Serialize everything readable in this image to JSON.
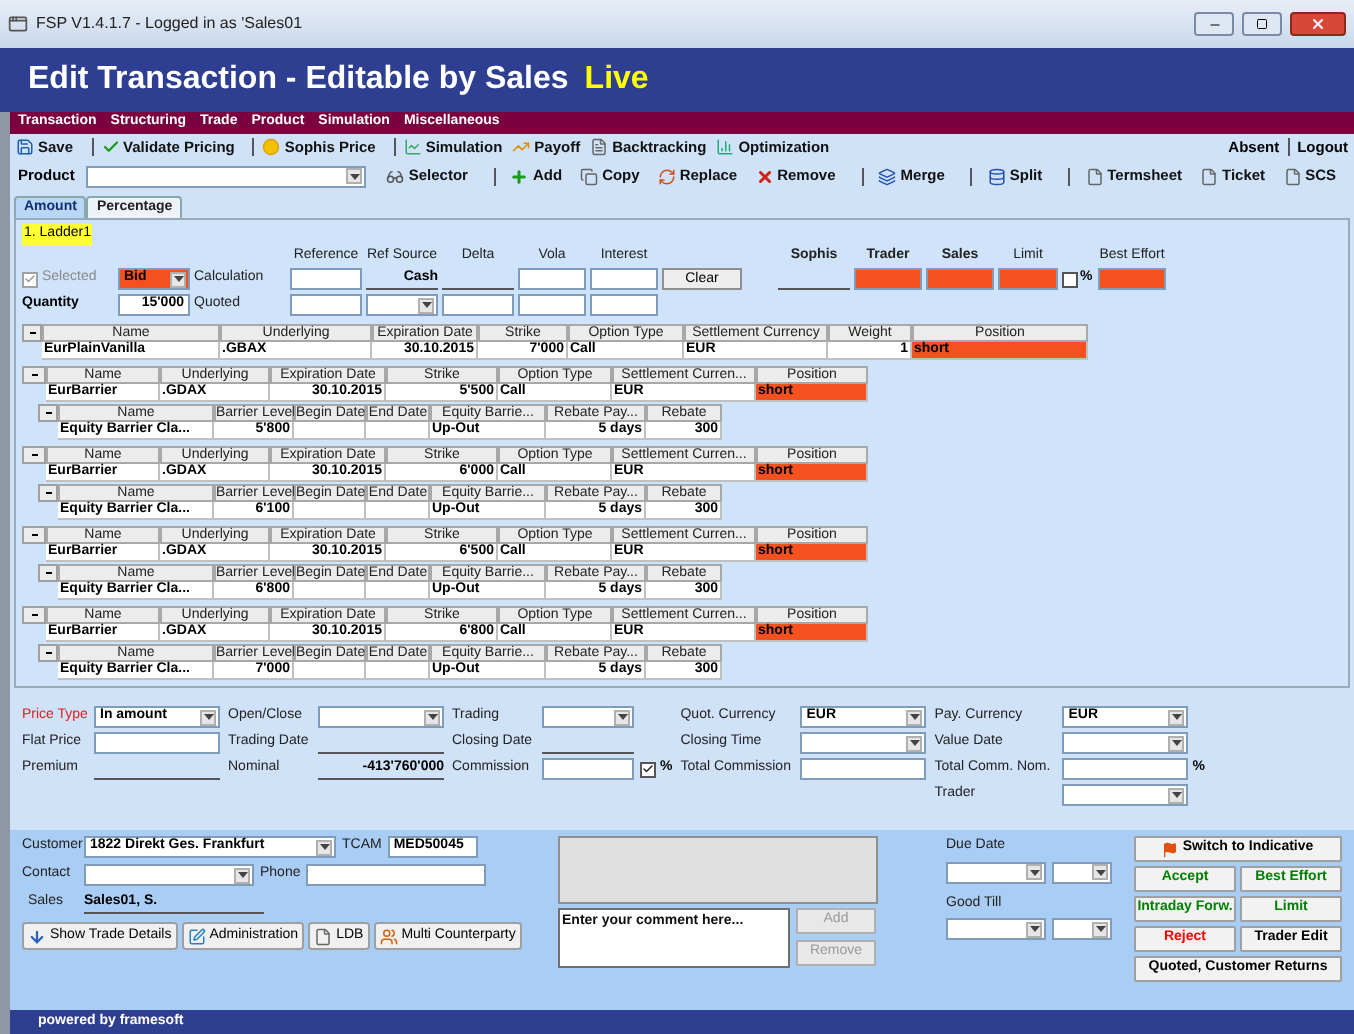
{
  "window": {
    "title": "FSP V1.4.1.7 - Logged in as 'Sales01"
  },
  "header": {
    "title": "Edit Transaction - Editable by Sales",
    "status": "Live"
  },
  "menu": [
    "Transaction",
    "Structuring",
    "Trade",
    "Product",
    "Simulation",
    "Miscellaneous"
  ],
  "toolbar": {
    "groups": [
      [
        "Save"
      ],
      [
        "Validate Pricing"
      ],
      [
        "Sophis Price"
      ],
      [
        "Simulation",
        "Payoff",
        "Backtracking",
        "Optimization"
      ]
    ],
    "right": [
      "Absent",
      "Logout"
    ]
  },
  "product_bar": {
    "label": "Product",
    "groups": [
      [
        "Selector"
      ],
      [
        "Add",
        "Copy",
        "Replace",
        "Remove"
      ],
      [
        "Merge"
      ],
      [
        "Split"
      ],
      [
        "Termsheet",
        "Ticket",
        "SCS"
      ]
    ]
  },
  "tabs": [
    {
      "label": "Amount",
      "selected": true
    },
    {
      "label": "Percentage",
      "selected": false
    }
  ],
  "ladder": {
    "title": "1. Ladder1",
    "selected": {
      "label": "Selected",
      "checked": true,
      "disabled": true
    },
    "side": "Bid",
    "quantity_label": "Quantity",
    "quantity": "15'000",
    "calculation_label": "Calculation",
    "quoted_label": "Quoted",
    "columns": [
      "Reference",
      "Ref Source",
      "Delta",
      "Vola",
      "Interest"
    ],
    "ref_source": "Cash",
    "clear_button": "Clear",
    "right_columns": [
      {
        "label": "Sophis",
        "bold": true
      },
      {
        "label": "Trader",
        "bold": true
      },
      {
        "label": "Sales",
        "bold": true
      },
      {
        "label": "Limit",
        "bold": false
      },
      {
        "label": "Best Effort",
        "bold": false
      }
    ],
    "limit_percent": {
      "label": "%",
      "checked": false
    }
  },
  "main_leg": {
    "columns": [
      "Name",
      "Underlying",
      "Expiration Date",
      "Strike",
      "Option Type",
      "Settlement Currency",
      "Weight",
      "Position"
    ],
    "row": [
      "EurPlainVanilla",
      ".GBAX",
      "30.10.2015",
      "7'000",
      "Call",
      "EUR",
      "1",
      "short"
    ]
  },
  "legs": [
    {
      "option": {
        "columns": [
          "Name",
          "Underlying",
          "Expiration Date",
          "Strike",
          "Option Type",
          "Settlement Curren...",
          "Position"
        ],
        "row": [
          "EurBarrier",
          ".GDAX",
          "30.10.2015",
          "5'500",
          "Call",
          "EUR",
          "short"
        ]
      },
      "barrier": {
        "columns": [
          "Name",
          "Barrier Level",
          "Begin Date",
          "End Date",
          "Equity Barrie...",
          "Rebate Pay...",
          "Rebate"
        ],
        "row": {
          "name": "Equity Barrier Cla...",
          "barrier_level": "5'800",
          "equity_barrier": "Up-Out",
          "rebate_pay": "5 days",
          "rebate": "300"
        }
      }
    },
    {
      "option": {
        "columns": [
          "Name",
          "Underlying",
          "Expiration Date",
          "Strike",
          "Option Type",
          "Settlement Curren...",
          "Position"
        ],
        "row": [
          "EurBarrier",
          ".GDAX",
          "30.10.2015",
          "6'000",
          "Call",
          "EUR",
          "short"
        ]
      },
      "barrier": {
        "columns": [
          "Name",
          "Barrier Level",
          "Begin Date",
          "End Date",
          "Equity Barrie...",
          "Rebate Pay...",
          "Rebate"
        ],
        "row": {
          "name": "Equity Barrier Cla...",
          "barrier_level": "6'100",
          "equity_barrier": "Up-Out",
          "rebate_pay": "5 days",
          "rebate": "300"
        }
      }
    },
    {
      "option": {
        "columns": [
          "Name",
          "Underlying",
          "Expiration Date",
          "Strike",
          "Option Type",
          "Settlement Curren...",
          "Position"
        ],
        "row": [
          "EurBarrier",
          ".GDAX",
          "30.10.2015",
          "6'500",
          "Call",
          "EUR",
          "short"
        ]
      },
      "barrier": {
        "columns": [
          "Name",
          "Barrier Level",
          "Begin Date",
          "End Date",
          "Equity Barrie...",
          "Rebate Pay...",
          "Rebate"
        ],
        "row": {
          "name": "Equity Barrier Cla...",
          "barrier_level": "6'800",
          "equity_barrier": "Up-Out",
          "rebate_pay": "5 days",
          "rebate": "300"
        }
      }
    },
    {
      "option": {
        "columns": [
          "Name",
          "Underlying",
          "Expiration Date",
          "Strike",
          "Option Type",
          "Settlement Curren...",
          "Position"
        ],
        "row": [
          "EurBarrier",
          ".GDAX",
          "30.10.2015",
          "6'800",
          "Call",
          "EUR",
          "short"
        ]
      },
      "barrier": {
        "columns": [
          "Name",
          "Barrier Level",
          "Begin Date",
          "End Date",
          "Equity Barrie...",
          "Rebate Pay...",
          "Rebate"
        ],
        "row": {
          "name": "Equity Barrier Cla...",
          "barrier_level": "7'000",
          "equity_barrier": "Up-Out",
          "rebate_pay": "5 days",
          "rebate": "300"
        }
      }
    }
  ],
  "form": [
    [
      {
        "label": "Price Type",
        "kind": "select",
        "value": "In amount",
        "required": true
      },
      {
        "label": "Flat Price",
        "kind": "input",
        "required": false
      },
      {
        "label": "Premium",
        "kind": "line",
        "required": false
      }
    ],
    [
      {
        "label": "Open/Close",
        "kind": "select",
        "required": false
      },
      {
        "label": "Trading Date",
        "kind": "line",
        "required": false
      },
      {
        "label": "Nominal",
        "kind": "line",
        "value": "-413'760'000",
        "required": false
      }
    ],
    [
      {
        "label": "Trading",
        "kind": "select",
        "required": false
      },
      {
        "label": "Closing Date",
        "kind": "line",
        "required": false
      },
      {
        "label": "Commission",
        "kind": "input",
        "checkbox": {
          "checked": true
        },
        "suffix": "%",
        "required": false
      }
    ],
    [
      {
        "label": "Quot. Currency",
        "kind": "select",
        "value": "EUR",
        "required": false
      },
      {
        "label": "Closing Time",
        "kind": "select",
        "required": false
      },
      {
        "label": "Total Commission",
        "kind": "input",
        "required": false
      }
    ],
    [
      {
        "label": "Pay. Currency",
        "kind": "select",
        "value": "EUR",
        "required": false
      },
      {
        "label": "Value Date",
        "kind": "select",
        "required": false
      },
      {
        "label": "Total Comm. Nom.",
        "kind": "input",
        "suffix": "%",
        "required": false
      },
      {
        "label": "Trader",
        "kind": "select",
        "required": false
      }
    ]
  ],
  "customer": {
    "customer_label": "Customer",
    "customer": "1822 Direkt Ges. Frankfurt",
    "tcam_label": "TCAM",
    "tcam": "MED50045",
    "contact_label": "Contact",
    "phone_label": "Phone",
    "sales_label": "Sales",
    "sales": "Sales01, S.",
    "buttons": [
      "Show Trade Details",
      "Administration",
      "LDB",
      "Multi Counterparty"
    ]
  },
  "comment": {
    "placeholder": "Enter your comment here...",
    "buttons": [
      {
        "label": "Add",
        "disabled": true
      },
      {
        "label": "Remove",
        "disabled": true
      }
    ]
  },
  "dates": [
    {
      "label": "Due Date"
    },
    {
      "label": "Good Till"
    }
  ],
  "actions": [
    {
      "label": "Switch to Indicative",
      "kind": "wide",
      "color": "#000000"
    },
    {
      "label": "Accept",
      "kind": "half",
      "color": "#008000"
    },
    {
      "label": "Best Effort",
      "kind": "half",
      "color": "#008000"
    },
    {
      "label": "Intraday Forw.",
      "kind": "half",
      "color": "#008000"
    },
    {
      "label": "Limit",
      "kind": "half",
      "color": "#008000"
    },
    {
      "label": "Reject",
      "kind": "half",
      "color": "#ff0000"
    },
    {
      "label": "Trader Edit",
      "kind": "half",
      "color": "#000000"
    },
    {
      "label": "Quoted, Customer Returns",
      "kind": "wide",
      "color": "#000000"
    }
  ],
  "footer": "powered by framesoft"
}
